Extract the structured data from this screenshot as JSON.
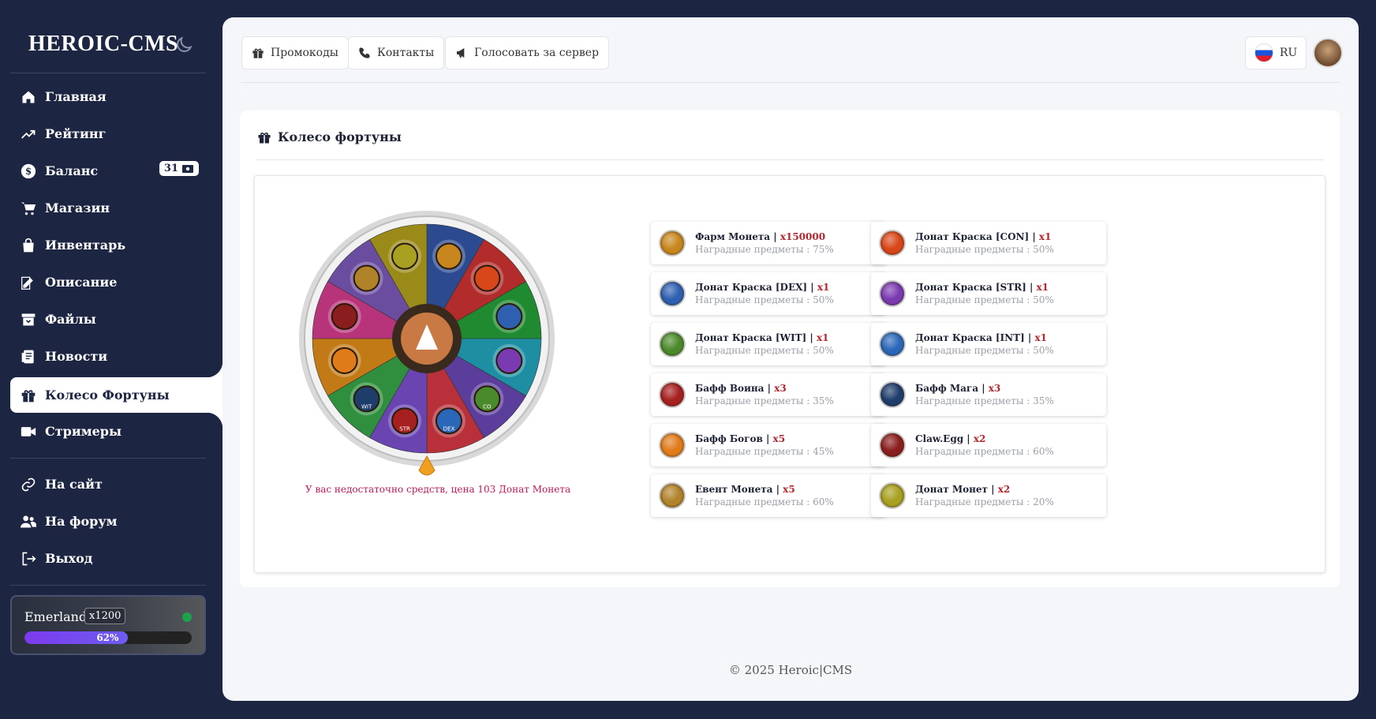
{
  "sidebar": {
    "brand": "HEROIC-CMS",
    "items": [
      {
        "label": "Главная",
        "icon": "home-icon"
      },
      {
        "label": "Рейтинг",
        "icon": "trending-up-icon"
      },
      {
        "label": "Баланс",
        "icon": "dollar-icon",
        "badge": "31"
      },
      {
        "label": "Магазин",
        "icon": "cart-icon"
      },
      {
        "label": "Инвентарь",
        "icon": "bag-icon"
      },
      {
        "label": "Описание",
        "icon": "edit-icon"
      },
      {
        "label": "Файлы",
        "icon": "archive-icon"
      },
      {
        "label": "Новости",
        "icon": "news-icon"
      },
      {
        "label": "Колесо Фортуны",
        "icon": "gift-icon",
        "active": true
      },
      {
        "label": "Стримеры",
        "icon": "video-icon"
      }
    ],
    "links": [
      {
        "label": "На сайт",
        "icon": "link-icon"
      },
      {
        "label": "На форум",
        "icon": "users-icon"
      },
      {
        "label": "Выход",
        "icon": "logout-icon"
      }
    ],
    "server": {
      "name": "Emerland",
      "rate": "x1200",
      "progress_label": "62%",
      "progress": 0.62,
      "status_color": "#1aa34a"
    }
  },
  "topbar": {
    "promo": "Промокоды",
    "contacts": "Контакты",
    "vote": "Голосовать за сервер",
    "lang": "RU"
  },
  "page": {
    "title": "Колесо фортуны",
    "error": "У вас недостаточно средств, цена 103 Донат Монета"
  },
  "prizes": [
    {
      "name": "Фарм Монета",
      "mult": "x150000",
      "chance": "Наградные предметы : 75%",
      "color": "#c8871e"
    },
    {
      "name": "Донат Краска [CON]",
      "mult": "x1",
      "chance": "Наградные предметы : 50%",
      "color": "#d8471a"
    },
    {
      "name": "Донат Краска [DEX]",
      "mult": "x1",
      "chance": "Наградные предметы : 50%",
      "color": "#2e5fb0"
    },
    {
      "name": "Донат Краска [STR]",
      "mult": "x1",
      "chance": "Наградные предметы : 50%",
      "color": "#7a3ab0"
    },
    {
      "name": "Донат Краска [WIT]",
      "mult": "x1",
      "chance": "Наградные предметы : 50%",
      "color": "#4b8a2c"
    },
    {
      "name": "Донат Краска [INT]",
      "mult": "x1",
      "chance": "Наградные предметы : 50%",
      "color": "#2b67b8"
    },
    {
      "name": "Бафф Воина",
      "mult": "x3",
      "chance": "Наградные предметы : 35%",
      "color": "#a62020"
    },
    {
      "name": "Бафф Мага",
      "mult": "x3",
      "chance": "Наградные предметы : 35%",
      "color": "#1f3d6b"
    },
    {
      "name": "Бафф Богов",
      "mult": "x5",
      "chance": "Наградные предметы : 45%",
      "color": "#e07b1a"
    },
    {
      "name": "Claw.Egg",
      "mult": "x2",
      "chance": "Наградные предметы : 60%",
      "color": "#8a1e1e"
    },
    {
      "name": "Евент Монета",
      "mult": "x5",
      "chance": "Наградные предметы : 60%",
      "color": "#b0822a"
    },
    {
      "name": "Донат Монет",
      "mult": "x2",
      "chance": "Наградные предметы : 20%",
      "color": "#a8a020"
    }
  ],
  "wheel": {
    "segment_colors": [
      "#2b4a8f",
      "#b22c2c",
      "#1f8a2f",
      "#1e8fa3",
      "#5b3e9c",
      "#b7303a",
      "#6a44b0",
      "#2f8f3e",
      "#c27a16",
      "#b8347a",
      "#6b4da0",
      "#9a8a1a"
    ],
    "slot_labels": [
      "",
      "",
      "",
      "",
      "CO",
      "DEX",
      "STR",
      "WIT",
      "",
      "",
      "",
      ""
    ]
  },
  "footer": "© 2025 Heroic|CMS"
}
